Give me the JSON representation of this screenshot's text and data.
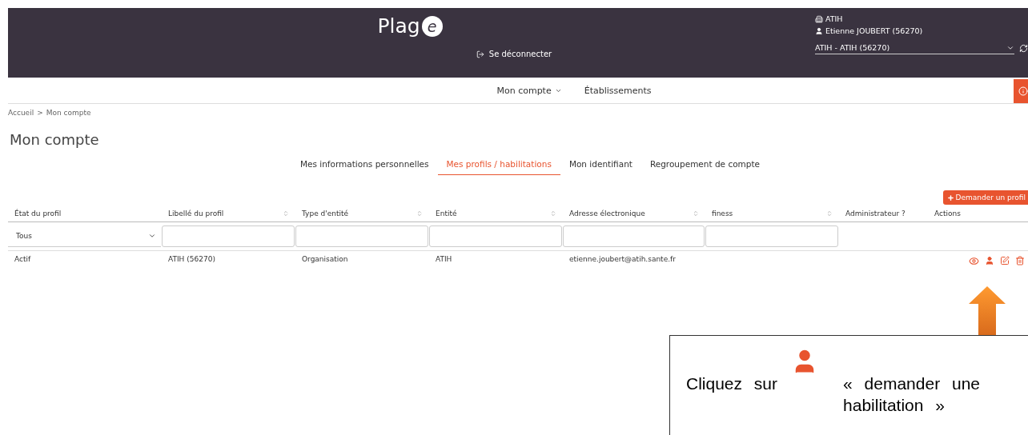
{
  "header": {
    "logo": {
      "text": "Plag",
      "badge": "e"
    },
    "logout": "Se déconnecter",
    "organization": "ATIH",
    "user": "Etienne JOUBERT (56270)",
    "account_select": {
      "value": "ATIH - ATIH (56270)"
    }
  },
  "nav": [
    {
      "label": "Mon compte",
      "dropdown": true
    },
    {
      "label": "Établissements",
      "dropdown": false
    }
  ],
  "breadcrumb": {
    "items": [
      "Accueil",
      "Mon compte"
    ],
    "separator": ">"
  },
  "page_title": "Mon compte",
  "tabs": [
    {
      "label": "Mes informations personnelles",
      "selected": false
    },
    {
      "label": "Mes profils / habilitations",
      "selected": true
    },
    {
      "label": "Mon identifiant",
      "selected": false
    },
    {
      "label": "Regroupement de compte",
      "selected": false
    }
  ],
  "request_button": "Demander un profil",
  "table": {
    "columns": [
      {
        "label": "État du profil",
        "sortable": false
      },
      {
        "label": "Libellé du profil",
        "sortable": true
      },
      {
        "label": "Type d'entité",
        "sortable": true
      },
      {
        "label": "Entité",
        "sortable": true
      },
      {
        "label": "Adresse électronique",
        "sortable": true
      },
      {
        "label": "finess",
        "sortable": true
      },
      {
        "label": "Administrateur ?",
        "sortable": false
      },
      {
        "label": "Actions",
        "sortable": false
      }
    ],
    "filters": [
      {
        "kind": "select",
        "value": "Tous"
      },
      {
        "kind": "text"
      },
      {
        "kind": "text"
      },
      {
        "kind": "text"
      },
      {
        "kind": "text"
      },
      {
        "kind": "text"
      },
      {
        "kind": "none"
      },
      {
        "kind": "none"
      }
    ],
    "rows": [
      {
        "cells": [
          "Actif",
          "ATIH (56270)",
          "Organisation",
          "ATIH",
          "etienne.joubert@atih.sante.fr",
          "",
          ""
        ]
      }
    ]
  },
  "callout": {
    "before": "Cliquez sur",
    "after": "« demander une habilitation »"
  }
}
